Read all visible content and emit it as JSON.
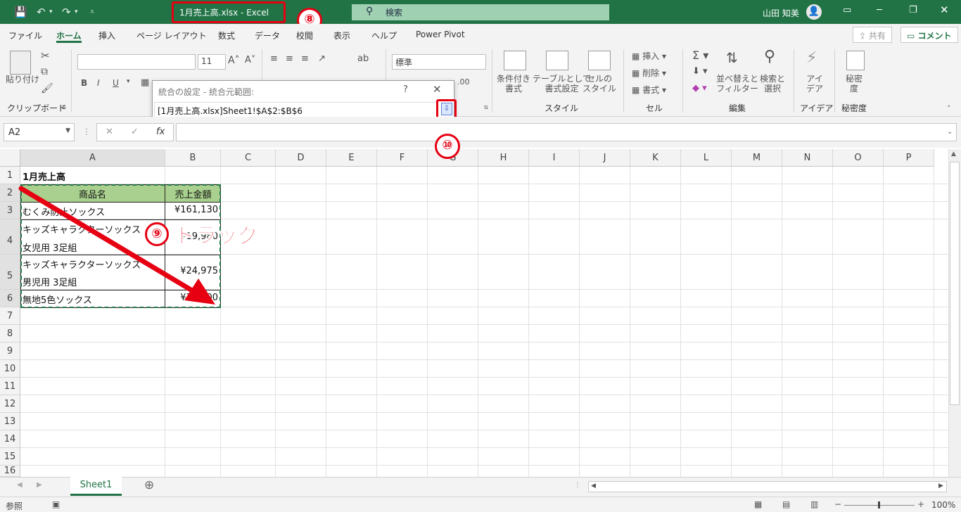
{
  "titlebar": {
    "title": "1月売上高.xlsx  -  Excel",
    "search_icon": "search-icon",
    "search_label": "検索",
    "user_name": "山田 知美",
    "qa_save_icon": "save-icon",
    "qa_undo_icon": "undo-icon",
    "qa_redo_icon": "redo-icon"
  },
  "tabs": [
    "ファイル",
    "ホーム",
    "挿入",
    "ページ レイアウト",
    "数式",
    "データ",
    "校閲",
    "表示",
    "ヘルプ",
    "Power Pivot"
  ],
  "share_label": "共有",
  "comment_label": "コメント",
  "ribbon": {
    "paste_label": "貼り付け",
    "clipboard_label": "クリップボード",
    "font_size": "11",
    "number_format": "標準",
    "style_cond": "条件付き\n書式",
    "style_table": "テーブルとして\n書式設定",
    "style_cell": "セルの\nスタイル",
    "style_group": "スタイル",
    "cell_insert": "挿入",
    "cell_delete": "削除",
    "cell_format": "書式",
    "cell_group": "セル",
    "edit_sort": "並べ替えと\nフィルター",
    "edit_find": "検索と\n選択",
    "edit_group": "編集",
    "idea_label": "アイ\nデア",
    "idea_group": "アイデア",
    "secret_label": "秘密\n度",
    "secret_group": "秘密度"
  },
  "dialog": {
    "title": "統合の設定 - 統合元範囲:",
    "help": "?",
    "close": "✕",
    "value": "[1月売上高.xlsx]Sheet1!$A$2:$B$6"
  },
  "formula": {
    "namebox": "A2",
    "fx": "fx",
    "cancel": "✕",
    "enter": "✓"
  },
  "columns": [
    "A",
    "B",
    "C",
    "D",
    "E",
    "F",
    "G",
    "H",
    "I",
    "J",
    "K",
    "L",
    "M",
    "N",
    "O",
    "P"
  ],
  "rows": [
    "1",
    "2",
    "3",
    "4",
    "5",
    "6",
    "7",
    "8",
    "9",
    "10",
    "11",
    "12",
    "13",
    "14",
    "15",
    "16"
  ],
  "cells": {
    "a1": "1月売上高",
    "a2": "商品名",
    "b2": "売上金額",
    "a3": "むくみ防止ソックス",
    "b3": "¥161,130",
    "a4_l1": "キッズキャラクターソックス",
    "a4_l2": "女児用 3足組",
    "b4": "¥19,980",
    "a5_l1": "キッズキャラクターソックス",
    "a5_l2": "男児用 3足組",
    "b5": "¥24,975",
    "a6": "無地5色ソックス",
    "b6": "¥32,100"
  },
  "sheet": {
    "tab": "Sheet1",
    "add": "⊕",
    "status": "参照",
    "zoom": "100%"
  },
  "annotations": {
    "step8": "⑧",
    "step9": "⑨",
    "drag": "ドラッグ",
    "step10": "⑩"
  },
  "colors": {
    "excel_green": "#217346",
    "header_fill": "#a9d08e",
    "annotation_red": "#e60012"
  }
}
